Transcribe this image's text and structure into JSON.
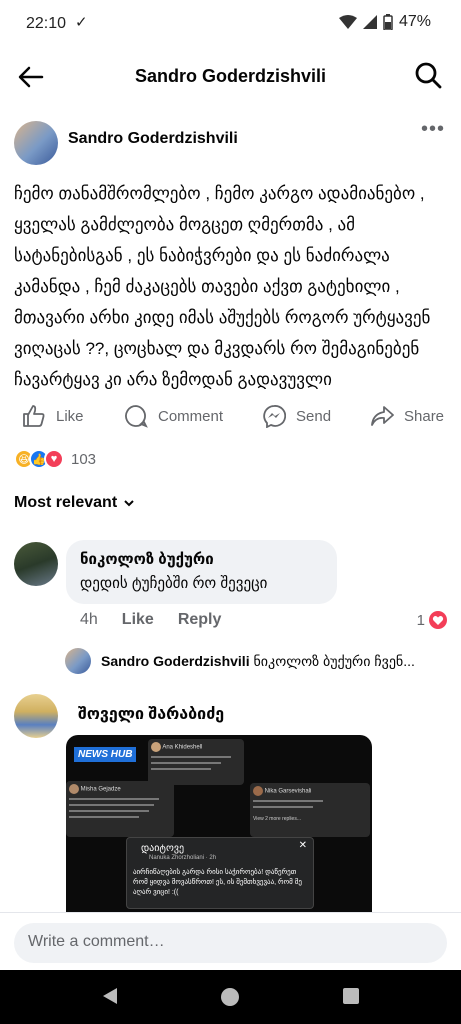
{
  "status_bar": {
    "time": "22:10",
    "battery": "47%"
  },
  "header": {
    "title": "Sandro Goderdzishvili"
  },
  "post": {
    "author": "Sandro Goderdzishvili",
    "text": "ჩემო თანამშრომლებო , ჩემო კარგო ადამიანებო , ყველას გამძლეობა მოგცეთ ღმერთმა , ამ სატანებისგან , ეს ნაბიჭვრები და ეს ნაძირალა კამანდა , ჩემ ძაკაცებს თავები აქვთ გატეხილი , მთავარი არხი კიდე იმას აშუქებს როგორ ურტყავენ ვიღაცას ??, ცოცხალ და მკვდარს რო შემაგინებენ ჩავარტყავ კი არა ზემოდან გადავუვლი",
    "actions": {
      "like": "Like",
      "comment": "Comment",
      "send": "Send",
      "share": "Share"
    },
    "reaction_count": "103"
  },
  "sort_label": "Most relevant",
  "comments": [
    {
      "author": "ნიკოლოზ ბუქური",
      "text": "დედის ტუჩებში რო შევეცი",
      "time": "4h",
      "like_label": "Like",
      "reply_label": "Reply",
      "likes": "1"
    }
  ],
  "reply": {
    "author": "Sandro Goderdzishvili",
    "text": "ნიკოლოზ ბუქური ჩვენ..."
  },
  "comment2": {
    "author": "შოველი შარაბიძე",
    "image": {
      "badge": "NEWS HUB",
      "popup_title": "დაიტოვე",
      "popup_author": "Nanuka Zhorzholiani · 2h",
      "popup_body": "აირჩიწაღების გარდა რისი საჭიროება! დაწერეთ რომ ყიდვა მოვასწროთ! ეს, ის შემთხვევაა, რომ მე აღარ ვიცი! :((",
      "box1_name": "Ana Khideshell",
      "box2_name": "Misha Gejadze",
      "box3_name": "Nika Garsevishali",
      "view_more": "View 2 more replies..."
    }
  },
  "composer": {
    "placeholder": "Write a comment…"
  }
}
